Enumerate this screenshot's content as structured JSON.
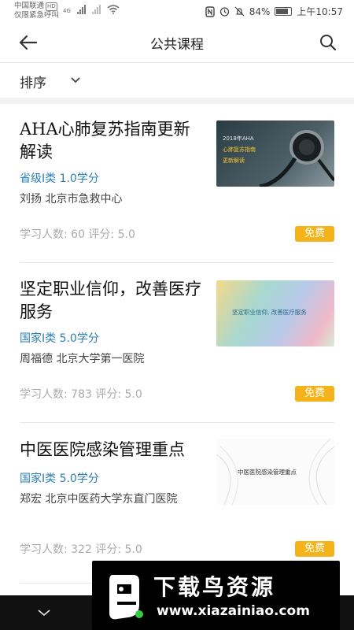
{
  "status_bar": {
    "carrier_line1": "中国联通",
    "carrier_badge": "HD",
    "carrier_line2": "仅限紧急呼叫",
    "network": "4G",
    "battery": "84%",
    "time": "上午10:57"
  },
  "header": {
    "title": "公共课程"
  },
  "sort": {
    "label": "排序"
  },
  "courses": [
    {
      "title": "AHA心肺复苏指南更新解读",
      "category": "省级I类  1.0学分",
      "teacher": "刘扬   北京市急救中心",
      "stats": "学习人数: 60   评分: 5.0",
      "badge": "免费",
      "thumb_line1": "2018年AHA",
      "thumb_line2": "心肺复苏指南",
      "thumb_line3": "更新解读"
    },
    {
      "title": "坚定职业信仰，改善医疗服务",
      "category": "国家I类  5.0学分",
      "teacher": "周福德   北京大学第一医院",
      "stats": "学习人数: 783   评分: 5.0",
      "badge": "免费",
      "thumb_text": "坚定职业信仰, 改善医疗服务"
    },
    {
      "title": "中医医院感染管理重点",
      "category": "国家I类  5.0学分",
      "teacher": "郑宏   北京中医药大学东直门医院",
      "stats": "学习人数: 322   评分: 5.0",
      "badge": "免费",
      "thumb_text": "中医医院感染管理重点"
    }
  ],
  "watermark": {
    "title": "下载鸟资源",
    "url": "www.xiazainiao.com"
  },
  "colors": {
    "accent_blue": "#2a7fb0",
    "badge_orange": "#f5b31b"
  }
}
